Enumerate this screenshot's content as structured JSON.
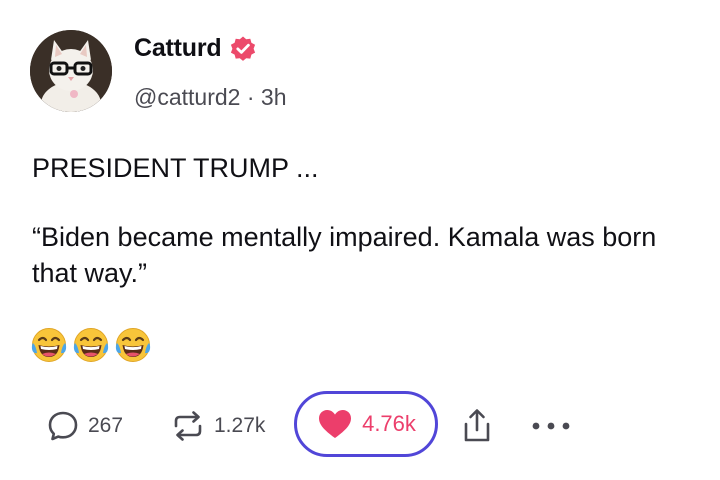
{
  "author": {
    "display_name": "Catturd",
    "handle": "@catturd2",
    "separator": "·",
    "time_ago": "3h",
    "verified": true,
    "verified_color": "#ec4a6b"
  },
  "post": {
    "line1": "PRESIDENT TRUMP ...",
    "quote": "“Biden became mentally impaired. Kamala was born that way.”",
    "emojis": [
      "tears-of-joy",
      "tears-of-joy",
      "tears-of-joy"
    ]
  },
  "actions": {
    "reply_count": "267",
    "repost_count": "1.27k",
    "like_count": "4.76k",
    "like_active": true,
    "like_color": "#ec3e6b",
    "highlight_color": "#5146d8"
  }
}
